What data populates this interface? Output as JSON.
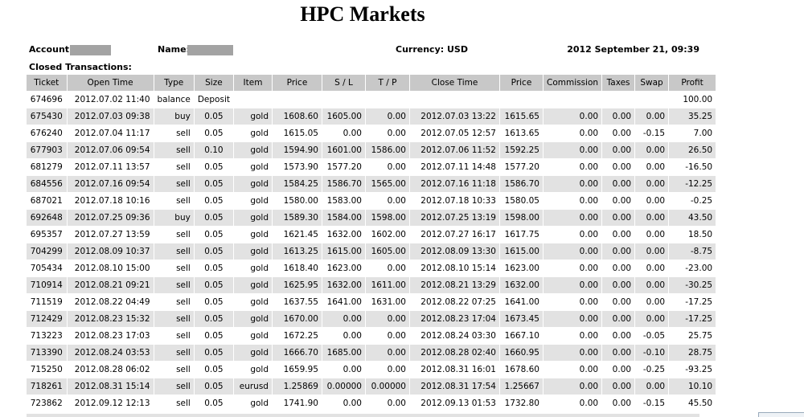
{
  "title": "HPC Markets",
  "header": {
    "account_label": "Account:",
    "name_label": "Name:",
    "currency": "Currency: USD",
    "datetime": "2012 September 21, 09:39"
  },
  "section_label": "Closed Transactions:",
  "columns": [
    "Ticket",
    "Open Time",
    "Type",
    "Size",
    "Item",
    "Price",
    "S / L",
    "T / P",
    "Close Time",
    "Price",
    "Commission",
    "Taxes",
    "Swap",
    "Profit"
  ],
  "rows": [
    [
      "674696",
      "2012.07.02 11:40",
      "balance",
      "Deposit",
      "",
      "",
      "",
      "",
      "",
      "",
      "",
      "",
      "",
      "100.00"
    ],
    [
      "675430",
      "2012.07.03 09:38",
      "buy",
      "0.05",
      "gold",
      "1608.60",
      "1605.00",
      "0.00",
      "2012.07.03 13:22",
      "1615.65",
      "0.00",
      "0.00",
      "0.00",
      "35.25"
    ],
    [
      "676240",
      "2012.07.04 11:17",
      "sell",
      "0.05",
      "gold",
      "1615.05",
      "0.00",
      "0.00",
      "2012.07.05 12:57",
      "1613.65",
      "0.00",
      "0.00",
      "-0.15",
      "7.00"
    ],
    [
      "677903",
      "2012.07.06 09:54",
      "sell",
      "0.10",
      "gold",
      "1594.90",
      "1601.00",
      "1586.00",
      "2012.07.06 11:52",
      "1592.25",
      "0.00",
      "0.00",
      "0.00",
      "26.50"
    ],
    [
      "681279",
      "2012.07.11 13:57",
      "sell",
      "0.05",
      "gold",
      "1573.90",
      "1577.20",
      "0.00",
      "2012.07.11 14:48",
      "1577.20",
      "0.00",
      "0.00",
      "0.00",
      "-16.50"
    ],
    [
      "684556",
      "2012.07.16 09:54",
      "sell",
      "0.05",
      "gold",
      "1584.25",
      "1586.70",
      "1565.00",
      "2012.07.16 11:18",
      "1586.70",
      "0.00",
      "0.00",
      "0.00",
      "-12.25"
    ],
    [
      "687021",
      "2012.07.18 10:16",
      "sell",
      "0.05",
      "gold",
      "1580.00",
      "1583.00",
      "0.00",
      "2012.07.18 10:33",
      "1580.05",
      "0.00",
      "0.00",
      "0.00",
      "-0.25"
    ],
    [
      "692648",
      "2012.07.25 09:36",
      "buy",
      "0.05",
      "gold",
      "1589.30",
      "1584.00",
      "1598.00",
      "2012.07.25 13:19",
      "1598.00",
      "0.00",
      "0.00",
      "0.00",
      "43.50"
    ],
    [
      "695357",
      "2012.07.27 13:59",
      "sell",
      "0.05",
      "gold",
      "1621.45",
      "1632.00",
      "1602.00",
      "2012.07.27 16:17",
      "1617.75",
      "0.00",
      "0.00",
      "0.00",
      "18.50"
    ],
    [
      "704299",
      "2012.08.09 10:37",
      "sell",
      "0.05",
      "gold",
      "1613.25",
      "1615.00",
      "1605.00",
      "2012.08.09 13:30",
      "1615.00",
      "0.00",
      "0.00",
      "0.00",
      "-8.75"
    ],
    [
      "705434",
      "2012.08.10 15:00",
      "sell",
      "0.05",
      "gold",
      "1618.40",
      "1623.00",
      "0.00",
      "2012.08.10 15:14",
      "1623.00",
      "0.00",
      "0.00",
      "0.00",
      "-23.00"
    ],
    [
      "710914",
      "2012.08.21 09:21",
      "sell",
      "0.05",
      "gold",
      "1625.95",
      "1632.00",
      "1611.00",
      "2012.08.21 13:29",
      "1632.00",
      "0.00",
      "0.00",
      "0.00",
      "-30.25"
    ],
    [
      "711519",
      "2012.08.22 04:49",
      "sell",
      "0.05",
      "gold",
      "1637.55",
      "1641.00",
      "1631.00",
      "2012.08.22 07:25",
      "1641.00",
      "0.00",
      "0.00",
      "0.00",
      "-17.25"
    ],
    [
      "712429",
      "2012.08.23 15:32",
      "sell",
      "0.05",
      "gold",
      "1670.00",
      "0.00",
      "0.00",
      "2012.08.23 17:04",
      "1673.45",
      "0.00",
      "0.00",
      "0.00",
      "-17.25"
    ],
    [
      "713223",
      "2012.08.23 17:03",
      "sell",
      "0.05",
      "gold",
      "1672.25",
      "0.00",
      "0.00",
      "2012.08.24 03:30",
      "1667.10",
      "0.00",
      "0.00",
      "-0.05",
      "25.75"
    ],
    [
      "713390",
      "2012.08.24 03:53",
      "sell",
      "0.05",
      "gold",
      "1666.70",
      "1685.00",
      "0.00",
      "2012.08.28 02:40",
      "1660.95",
      "0.00",
      "0.00",
      "-0.10",
      "28.75"
    ],
    [
      "715250",
      "2012.08.28 06:02",
      "sell",
      "0.05",
      "gold",
      "1659.95",
      "0.00",
      "0.00",
      "2012.08.31 16:01",
      "1678.60",
      "0.00",
      "0.00",
      "-0.25",
      "-93.25"
    ],
    [
      "718261",
      "2012.08.31 15:14",
      "sell",
      "0.05",
      "eurusd",
      "1.25869",
      "0.00000",
      "0.00000",
      "2012.08.31 17:54",
      "1.25667",
      "0.00",
      "0.00",
      "0.00",
      "10.10"
    ],
    [
      "723862",
      "2012.09.12 12:13",
      "sell",
      "0.05",
      "gold",
      "1741.90",
      "0.00",
      "0.00",
      "2012.09.13 01:53",
      "1732.80",
      "0.00",
      "0.00",
      "-0.15",
      "45.50"
    ]
  ],
  "colors": {
    "header_bg": "#c8c8c8",
    "alt_row_bg": "#e2e2e2",
    "redaction": "#a3a3a3"
  }
}
